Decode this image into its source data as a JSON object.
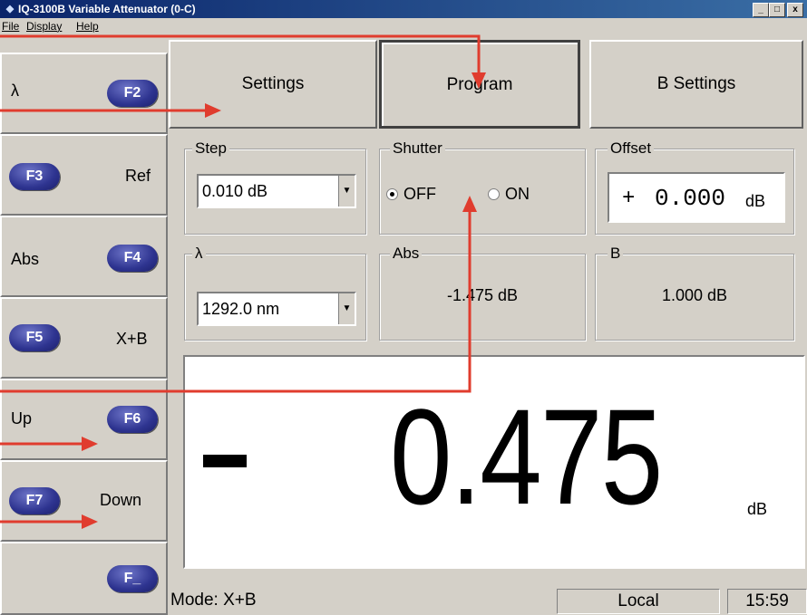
{
  "window": {
    "title": "IQ-3100B Variable Attenuator (0-C)",
    "controls": [
      "_",
      "□",
      "x"
    ]
  },
  "menu": {
    "items": [
      "File",
      "Display",
      "Help"
    ]
  },
  "fkeys": [
    {
      "label": "λ",
      "key": "F2"
    },
    {
      "label": "Ref",
      "key": "F3"
    },
    {
      "label": "Abs",
      "key": "F4"
    },
    {
      "label": "X+B",
      "key": "F5"
    },
    {
      "label": "Up",
      "key": "F6"
    },
    {
      "label": "Down",
      "key": "F7"
    },
    {
      "label": "",
      "key": "F_"
    }
  ],
  "tabs": {
    "settings": "Settings",
    "program": "Program",
    "b_settings": "B Settings"
  },
  "step": {
    "label": "Step",
    "value": "0.010 dB"
  },
  "shutter": {
    "label": "Shutter",
    "off": "OFF",
    "on": "ON",
    "selected": "OFF"
  },
  "offset": {
    "label": "Offset",
    "sign": "+",
    "value": "0.000",
    "unit": "dB"
  },
  "wavelength": {
    "label": "λ",
    "value": "1292.0 nm"
  },
  "abs": {
    "label": "Abs",
    "value": "-1.475 dB"
  },
  "b": {
    "label": "B",
    "value": "1.000 dB"
  },
  "display": {
    "value": "0.475",
    "unit": "dB"
  },
  "status": {
    "mode": "Mode: X+B",
    "remote": "Local",
    "time": "15:59"
  },
  "colors": {
    "annotation": "#e03c2e",
    "fkey_pill": "#2e3490",
    "titlebar": "#0a246a"
  }
}
